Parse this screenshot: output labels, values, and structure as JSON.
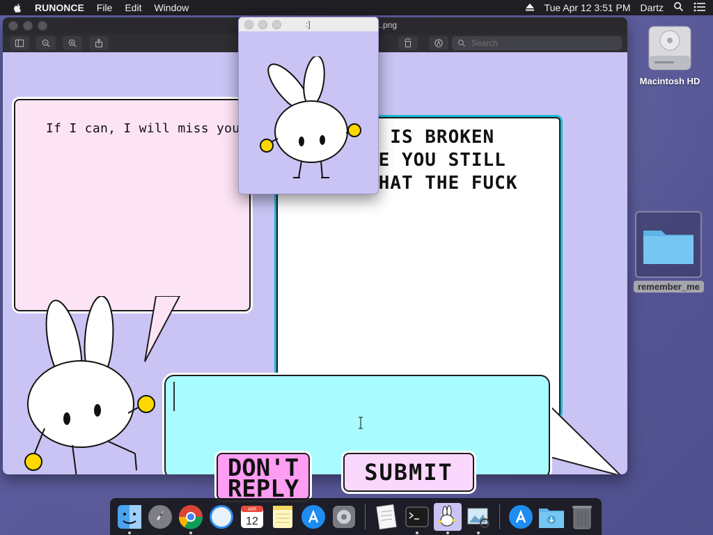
{
  "menubar": {
    "app_name": "RUNONCE",
    "items": [
      "File",
      "Edit",
      "Window"
    ],
    "datetime": "Tue Apr 12  3:51 PM",
    "user": "Dartz"
  },
  "main_window": {
    "title": "1.png",
    "search_placeholder": "Search",
    "speech_pink": "If I can, I will miss you.",
    "speech_white_lines": [
      "M IS BROKEN",
      "RE YOU STILL",
      "WHAT THE FUCK"
    ],
    "input_value": "",
    "buttons": {
      "dont_reply_line1": "DON'T",
      "dont_reply_line2": "REPLY",
      "submit": "SUBMIT"
    }
  },
  "popup_window": {
    "title": ":]"
  },
  "desktop": {
    "items": [
      {
        "label": "Macintosh HD",
        "icon": "hard-drive-icon"
      },
      {
        "label": "remember_me",
        "icon": "folder-icon"
      }
    ]
  },
  "dock": {
    "calendar_month": "APR",
    "calendar_day": "12",
    "items": [
      {
        "name": "finder",
        "icon": "finder-icon",
        "running": true
      },
      {
        "name": "launchpad",
        "icon": "rocket-icon",
        "running": false
      },
      {
        "name": "chrome",
        "icon": "chrome-icon",
        "running": true
      },
      {
        "name": "safari",
        "icon": "safari-icon",
        "running": false
      },
      {
        "name": "calendar",
        "icon": "calendar-icon",
        "running": false
      },
      {
        "name": "notes",
        "icon": "notes-icon",
        "running": false
      },
      {
        "name": "app-store",
        "icon": "app-store-icon",
        "running": false
      },
      {
        "name": "system-preferences",
        "icon": "gear-icon",
        "running": false
      },
      {
        "name": "textedit",
        "icon": "document-icon",
        "running": false
      },
      {
        "name": "terminal",
        "icon": "terminal-icon",
        "running": true
      },
      {
        "name": "runonce",
        "icon": "bunny-icon",
        "running": true
      },
      {
        "name": "preview",
        "icon": "preview-icon",
        "running": true
      },
      {
        "name": "app-store-2",
        "icon": "app-store-icon",
        "running": false
      },
      {
        "name": "downloads",
        "icon": "downloads-folder-icon",
        "running": false
      },
      {
        "name": "trash",
        "icon": "trash-icon",
        "running": false
      }
    ]
  },
  "colors": {
    "canvas_bg": "#c9c4f3",
    "pink_bubble": "#fde4f5",
    "cyan_bubble": "#a8fbff",
    "dont_reply_button": "#ff9cf3",
    "submit_button": "#fad7fd",
    "bunny_hands": "#ffd800"
  }
}
